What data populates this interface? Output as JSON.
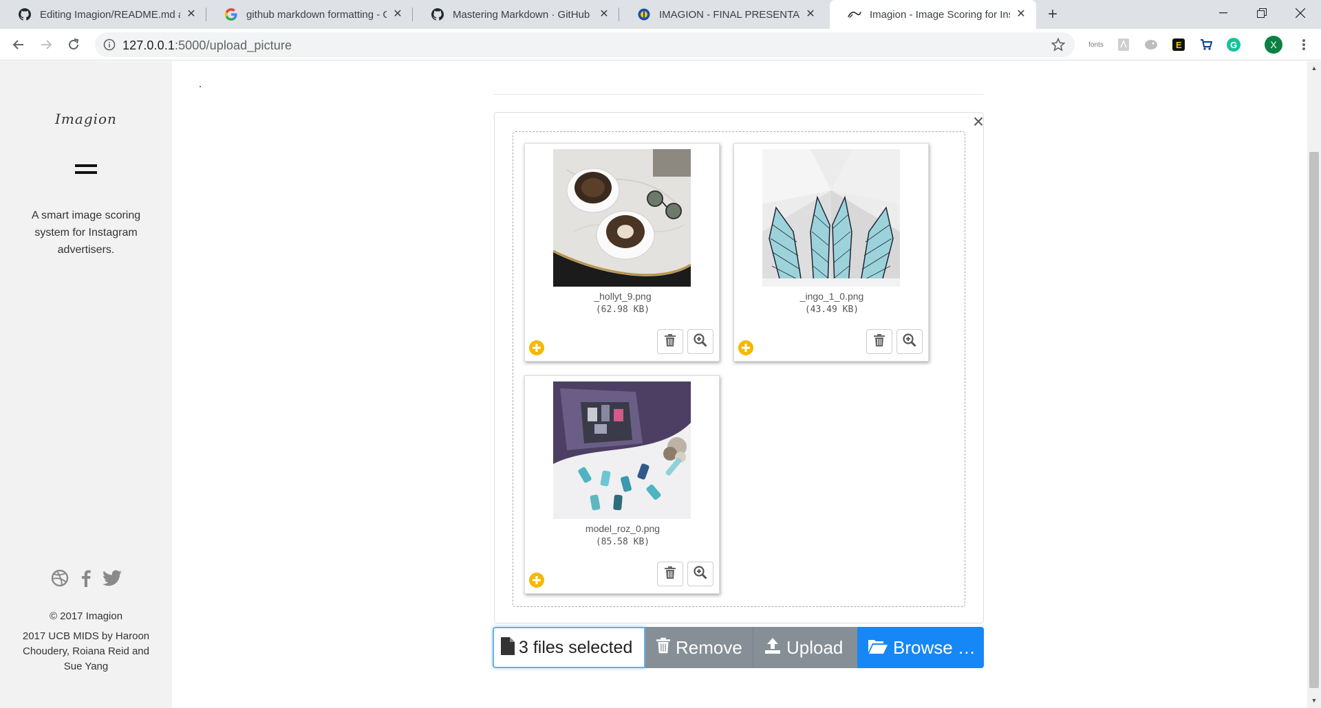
{
  "browser": {
    "tabs": [
      {
        "title": "Editing Imagion/README.md at",
        "icon": "github-icon"
      },
      {
        "title": "github markdown formatting - G",
        "icon": "google-icon"
      },
      {
        "title": "Mastering Markdown · GitHub G",
        "icon": "github-icon"
      },
      {
        "title": "IMAGION - FINAL PRESENTATION",
        "icon": "slides-icon"
      },
      {
        "title": "Imagion - Image Scoring for Insta",
        "icon": "imagion-icon"
      }
    ],
    "url_host": "127.0.0.1",
    "url_path": ":5000/upload_picture",
    "ext_fonts_label": "fonts",
    "profile_initial": "X"
  },
  "sidebar": {
    "logo": "Imagion",
    "tagline": "A smart image scoring system for Instagram advertisers.",
    "copyright": "© 2017 Imagion",
    "credits": "2017 UCB MIDS by Haroon Choudery, Roiana Reid and Sue Yang"
  },
  "uploader": {
    "files": [
      {
        "name": "_hollyt_9.png",
        "size": "(62.98 KB)"
      },
      {
        "name": "_ingo_1_0.png",
        "size": "(43.49 KB)"
      },
      {
        "name": "model_roz_0.png",
        "size": "(85.58 KB)"
      }
    ],
    "caption": "3 files selected",
    "remove_label": "Remove",
    "upload_label": "Upload",
    "browse_label": "Browse …"
  },
  "colors": {
    "browse_blue": "#1787f5",
    "button_gray": "#868e96",
    "plus_yellow": "#f5b800",
    "caption_focus": "#66afe9"
  }
}
